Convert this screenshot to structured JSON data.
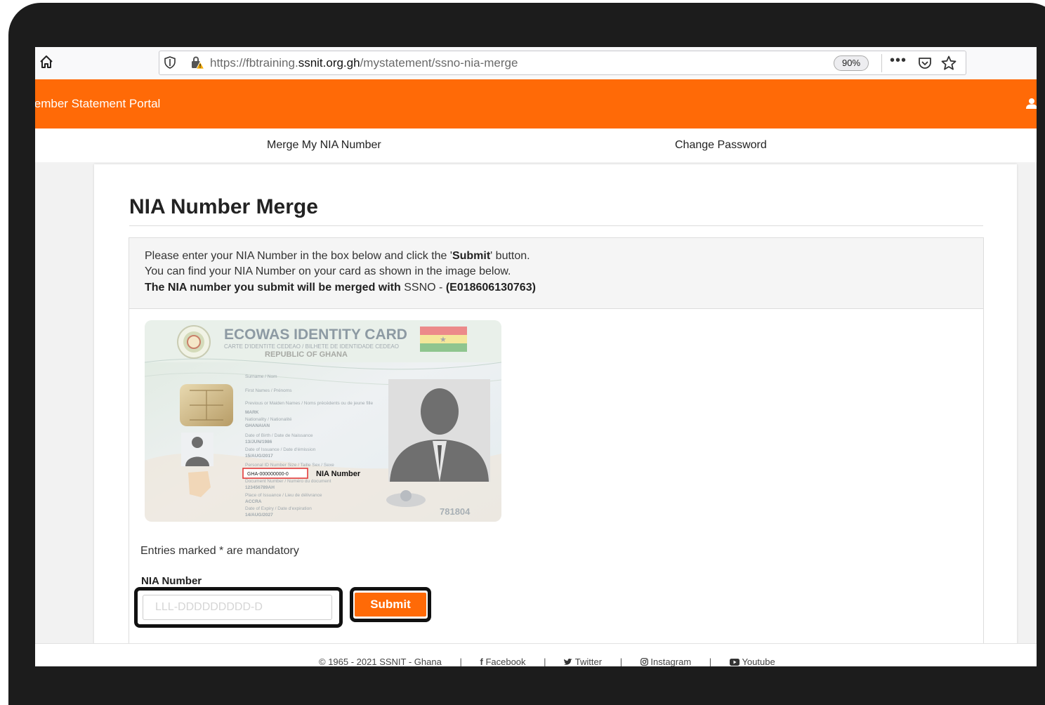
{
  "browser": {
    "url_prefix": "https://fbtraining.",
    "url_domain": "ssnit.org.gh",
    "url_path": "/mystatement/ssno-nia-merge",
    "zoom": "90%",
    "more_label": "•••"
  },
  "header": {
    "portal_title": "lember Statement Portal"
  },
  "nav": {
    "merge_label": "Merge My NIA Number",
    "password_label": "Change Password"
  },
  "main": {
    "title": "NIA Number Merge",
    "intro_line1_a": "Please enter your NIA Number in the box below and click the '",
    "intro_line1_b": "Submit",
    "intro_line1_c": "' button.",
    "intro_line2": "You can find your NIA Number on your card as shown in the image below.",
    "intro_line3_a": "The NIA number you submit will be merged with",
    "intro_line3_b": "SSNO -",
    "intro_line3_c": "(E018606130763)",
    "mandatory_note": "Entries marked * are mandatory",
    "nia_label": "NIA Number",
    "nia_placeholder": "LLL-DDDDDDDDD-D",
    "nia_value": "",
    "submit_label": "Submit"
  },
  "card_image": {
    "title": "ECOWAS IDENTITY CARD",
    "subtitle": "CARTE D'IDENTITE CEDEAO / BILHETE DE IDENTIDADE CEDEAO",
    "country": "REPUBLIC OF GHANA",
    "fields": [
      "Surname / Nom",
      "First Names / Prénoms",
      "Previous or Maiden Names / Noms précédents ou de jeune fille",
      "MARK",
      "Nationality / Nationalité",
      "GHANAIAN",
      "Date of Birth / Date de Naissance",
      "13/JUN/1986",
      "Date of Issuance / Date d'émission",
      "15/AUG/2017",
      "Personal ID Number   Size / Taille   Sex / Sexe",
      "Document Number / Numéro du document",
      "123456789AH",
      "Place of Issuance / Lieu de délivrance",
      "ACCRA",
      "Date of Expiry / Date d'expiration",
      "14/AUG/2027"
    ],
    "pin_sample": "GHA-000000000-0",
    "pin_callout": "NIA Number",
    "card_number": "781804"
  },
  "footer": {
    "copyright": "© 1965 - 2021 SSNIT - Ghana",
    "separator": "|",
    "facebook": "Facebook",
    "twitter": "Twitter",
    "instagram": "Instagram",
    "youtube": "Youtube"
  },
  "colors": {
    "brand_orange": "#ff6a07",
    "outline": "#111111"
  },
  "icons": [
    "home-icon",
    "shield-icon",
    "lock-warning-icon",
    "pocket-icon",
    "star-icon",
    "user-icon",
    "facebook-icon",
    "twitter-icon",
    "instagram-icon",
    "youtube-icon"
  ]
}
